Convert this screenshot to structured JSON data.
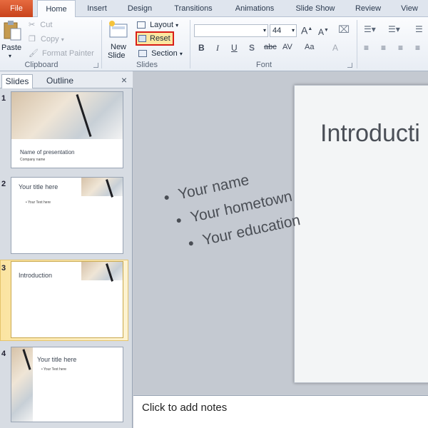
{
  "tabs": [
    "File",
    "Home",
    "Insert",
    "Design",
    "Transitions",
    "Animations",
    "Slide Show",
    "Review",
    "View"
  ],
  "clipboard": {
    "paste": "Paste",
    "cut": "Cut",
    "copy": "Copy",
    "format_painter": "Format Painter",
    "group": "Clipboard"
  },
  "slides_group": {
    "new_slide_line1": "New",
    "new_slide_line2": "Slide",
    "layout": "Layout",
    "reset": "Reset",
    "section": "Section",
    "group": "Slides"
  },
  "font_group": {
    "font_name": "",
    "font_size": "44",
    "group": "Font",
    "bold": "B",
    "italic": "I",
    "underline": "U",
    "shadow": "S",
    "strike": "abc",
    "spacing": "AV",
    "case": "Aa",
    "color": "A"
  },
  "left_pane": {
    "tab_slides": "Slides",
    "tab_outline": "Outline",
    "close": "×"
  },
  "thumbnails": [
    {
      "num": "1",
      "title": "Name of presentation",
      "sub": "Company name"
    },
    {
      "num": "2",
      "title": "Your title here",
      "sub": "• Your Text here"
    },
    {
      "num": "3",
      "title": "Introduction",
      "sub": ""
    },
    {
      "num": "4",
      "title": "Your title here",
      "sub": "• Your Text here"
    }
  ],
  "slide": {
    "title": "Introducti",
    "bullets": [
      "Your name",
      "Your hometown",
      "Your education"
    ]
  },
  "notes": {
    "placeholder": "Click to add notes"
  },
  "colors": {
    "file_tab": "#d2532a",
    "reset_highlight": "#d91e18",
    "selected_slide": "#fbe4a1"
  }
}
